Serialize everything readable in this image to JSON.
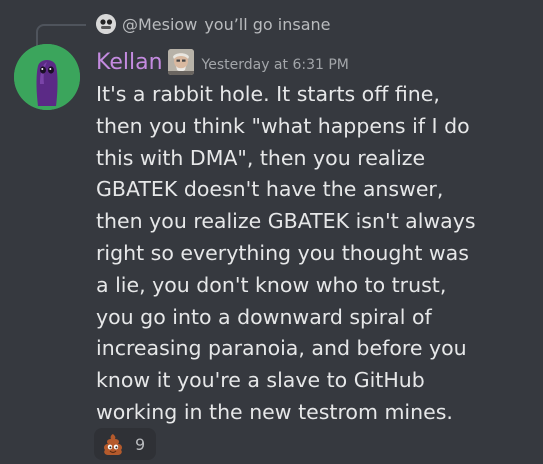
{
  "reply": {
    "author": "@Mesiow",
    "text": "you’ll go insane",
    "avatar_icon": "reply-avatar-icon"
  },
  "message": {
    "author": "Kellan",
    "author_color": "#c48be0",
    "role_icon": "portrait-icon",
    "timestamp": "Yesterday at 6:31 PM",
    "avatar_color": "#3ba55c",
    "lines": [
      "It's a rabbit hole. It starts off fine,",
      "then you think \"what happens if I do",
      "this with DMA\", then you realize",
      "GBATEK doesn't have the answer,",
      "then you realize GBATEK isn't always",
      "right so everything you thought was",
      "a lie, you don't know who to trust,",
      "you go into a downward spiral of",
      "increasing paranoia, and before you",
      "know it you're a slave to GitHub",
      "working in the new testrom mines."
    ]
  },
  "reaction": {
    "emoji": "poop-emoji-icon",
    "count": "9"
  }
}
